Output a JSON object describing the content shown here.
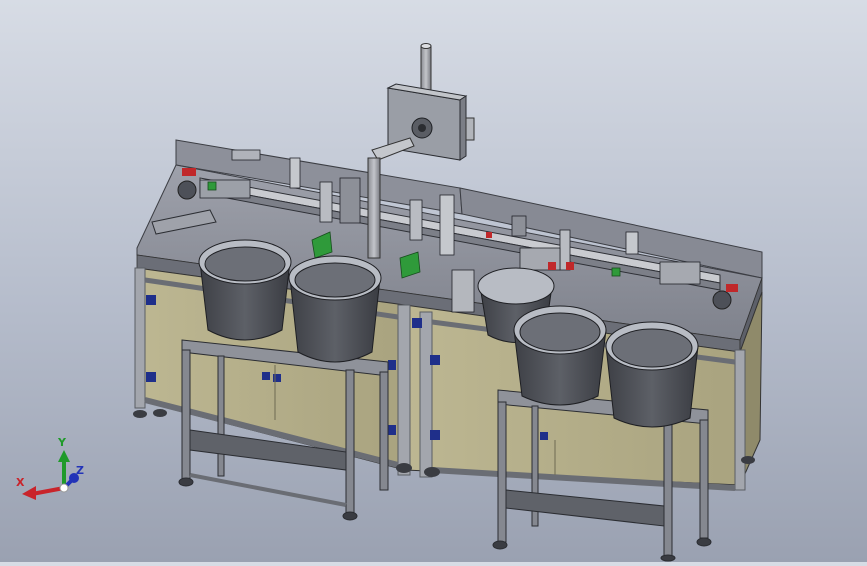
{
  "viewport": {
    "background_top": "#d7dce5",
    "background_bottom": "#9aa1b1",
    "model_colors": {
      "frame": "#7c7f86",
      "tabletop": "#8f929c",
      "panel": "#b4af8a",
      "bowl": "#4c4e54",
      "bowl_rim": "#b8bcc4",
      "accent_green": "#2f9a3a",
      "accent_red": "#c0282a",
      "accent_blue": "#1f2f8a"
    }
  },
  "triad": {
    "x_label": "X",
    "y_label": "Y",
    "z_label": "Z",
    "x_color": "#c9242b",
    "y_color": "#1f9a2a",
    "z_color": "#2233b8"
  }
}
